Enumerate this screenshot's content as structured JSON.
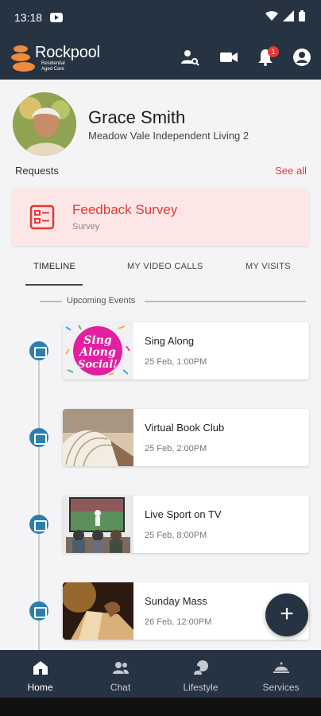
{
  "status_bar": {
    "time": "13:18"
  },
  "app": {
    "brand": "Rockpool",
    "brand_sub_line1": "Residential",
    "brand_sub_line2": "Aged Care"
  },
  "header": {
    "notification_count": "1"
  },
  "profile": {
    "name": "Grace Smith",
    "facility": "Meadow Vale Independent Living 2"
  },
  "requests": {
    "label": "Requests",
    "see_all": "See all",
    "card": {
      "title": "Feedback Survey",
      "subtitle": "Survey"
    }
  },
  "tabs": [
    {
      "label": "TIMELINE",
      "active": true
    },
    {
      "label": "MY VIDEO CALLS",
      "active": false
    },
    {
      "label": "MY VISITS",
      "active": false
    }
  ],
  "section_title": "Upcoming Events",
  "events": [
    {
      "title": "Sing Along",
      "date": "25 Feb, 1:00PM",
      "thumb_text_1": "Sing",
      "thumb_text_2": "Along",
      "thumb_text_3": "Social!"
    },
    {
      "title": "Virtual Book Club",
      "date": "25 Feb, 2:00PM"
    },
    {
      "title": "Live Sport on TV",
      "date": "25 Feb, 8:00PM"
    },
    {
      "title": "Sunday Mass",
      "date": "26 Feb, 12:00PM"
    }
  ],
  "fab": {
    "label": "+"
  },
  "bottom_nav": [
    {
      "label": "Home",
      "icon": "home-icon",
      "active": true
    },
    {
      "label": "Chat",
      "icon": "people-icon",
      "active": false
    },
    {
      "label": "Lifestyle",
      "icon": "lifestyle-icon",
      "active": false
    },
    {
      "label": "Services",
      "icon": "services-icon",
      "active": false
    }
  ],
  "colors": {
    "navy": "#263342",
    "accent_red": "#e53935",
    "survey_bg": "#fde6e6",
    "calendar_blue": "#2a7fb0",
    "logo_orange": "#f08a3c"
  }
}
